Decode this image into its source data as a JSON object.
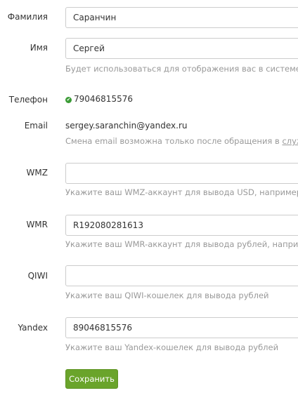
{
  "form": {
    "last_name": {
      "label": "Фамилия",
      "value": "Саранчин"
    },
    "first_name": {
      "label": "Имя",
      "value": "Сергей",
      "hint": "Будет использоваться для отображения вас в системе."
    },
    "phone": {
      "label": "Телефон",
      "value": "79046815576",
      "verified_icon": "check-circle-icon",
      "verified_color": "#3a9b35"
    },
    "email": {
      "label": "Email",
      "value": "sergey.saranchin@yandex.ru",
      "hint_prefix": "Смена email возможна только после обращения в ",
      "hint_link": "служ"
    },
    "wmz": {
      "label": "WMZ",
      "value": "",
      "hint": "Укажите ваш WMZ-аккаунт для вывода USD, например"
    },
    "wmr": {
      "label": "WMR",
      "value": "R192080281613",
      "hint": "Укажите ваш WMR-аккаунт для вывода рублей, наприм"
    },
    "qiwi": {
      "label": "QIWI",
      "value": "",
      "hint": "Укажите ваш QIWI-кошелек для вывода рублей"
    },
    "yandex": {
      "label": "Yandex",
      "value": "89046815576",
      "hint": "Укажите ваш Yandex-кошелек для вывода рублей"
    },
    "save_button": {
      "label": "Сохранить",
      "color": "#6aa42b"
    }
  }
}
